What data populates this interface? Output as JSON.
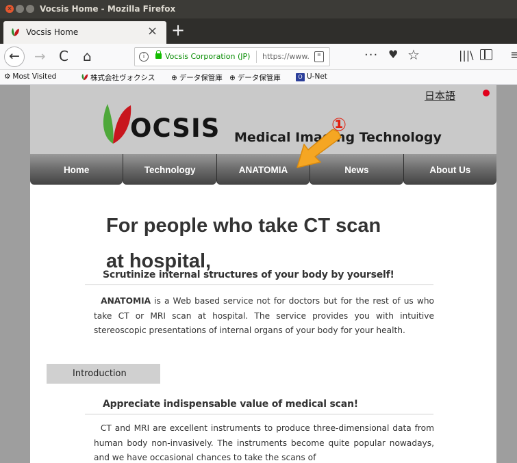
{
  "window": {
    "title": "Vocsis Home - Mozilla Firefox",
    "close_glyph": "×"
  },
  "tab": {
    "title": "Vocsis Home",
    "close_glyph": "×",
    "new_tab_glyph": "+"
  },
  "nav": {
    "back_glyph": "←",
    "forward_glyph": "→",
    "reload_glyph": "C",
    "home_glyph": "⌂",
    "info_glyph": "i",
    "identity": "Vocsis Corporation (JP)",
    "url": "https://www.",
    "reader_glyph": "≡",
    "overflow_glyph": "···",
    "pocket_glyph": "♥",
    "star_glyph": "☆",
    "library_glyph": "|||\\",
    "menu_glyph": "≡"
  },
  "bookmarks": {
    "most_visited": "Most Visited",
    "bm1": "株式会社ヴォクシス",
    "bm2": "データ保管庫",
    "bm3": "データ保管庫",
    "unet": "U-Net",
    "unet_icon_text": "O"
  },
  "site": {
    "language_link": "日本語",
    "logo_text": "OCSIS",
    "tagline": "Medical Imaging Technology",
    "menu": [
      "Home",
      "Technology",
      "ANATOMIA",
      "News",
      "About Us"
    ]
  },
  "annotation": {
    "marker": "①",
    "color": "#e02010",
    "arrow_color": "#f5a623"
  },
  "content": {
    "headline_line1": "For people who take CT scan",
    "headline_line2": "at hospital,",
    "subheading1": "Scrutinize internal structures of your body by yourself!",
    "para1_bold": "ANATOMIA",
    "para1_rest": " is a Web based service not for doctors but for the rest of us who take CT or MRI scan at hospital. The service provides you with intuitive stereoscopic presentations of internal organs of your body for your health.",
    "intro_tab": "Introduction",
    "subheading2": "Appreciate indispensable value of medical scan!",
    "para2": "CT and MRI are excellent instruments to produce three-dimensional data from human body non-invasively. The instruments become quite popular nowadays, and we have occasional chances to take the scans of"
  }
}
